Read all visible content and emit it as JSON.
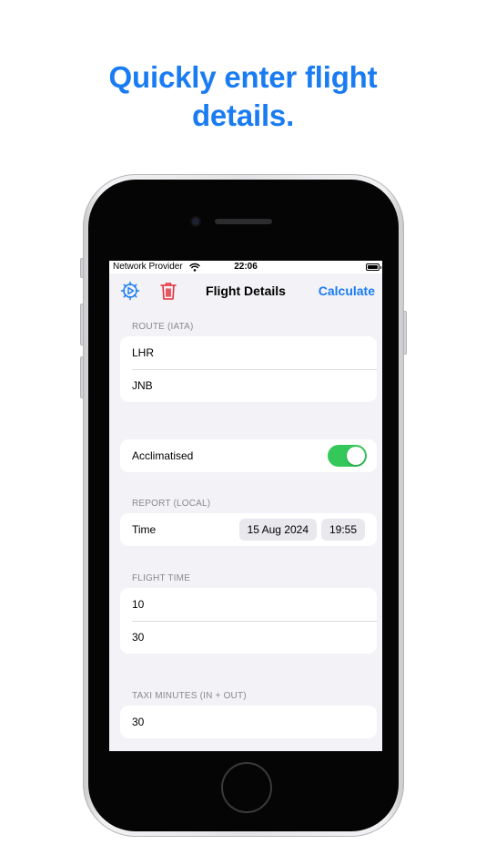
{
  "headline": {
    "line1": "Quickly enter flight",
    "line2": "details."
  },
  "status_bar": {
    "carrier": "Network Provider",
    "time": "22:06"
  },
  "nav": {
    "title": "Flight Details",
    "calculate_label": "Calculate"
  },
  "route": {
    "header": "ROUTE (IATA)",
    "origin": "LHR",
    "destination": "JNB"
  },
  "acclimatised": {
    "label": "Acclimatised",
    "on": true
  },
  "report": {
    "header": "REPORT (LOCAL)",
    "time_label": "Time",
    "date": "15 Aug 2024",
    "time": "19:55"
  },
  "flight_time": {
    "header": "FLIGHT TIME",
    "hours": "10",
    "minutes": "30"
  },
  "taxi": {
    "header": "TAXI MINUTES (IN + OUT)",
    "minutes": "30"
  },
  "colors": {
    "accent": "#1a7cf2",
    "toggle_on": "#34c759",
    "delete": "#e5323a",
    "background": "#f2f2f7"
  }
}
